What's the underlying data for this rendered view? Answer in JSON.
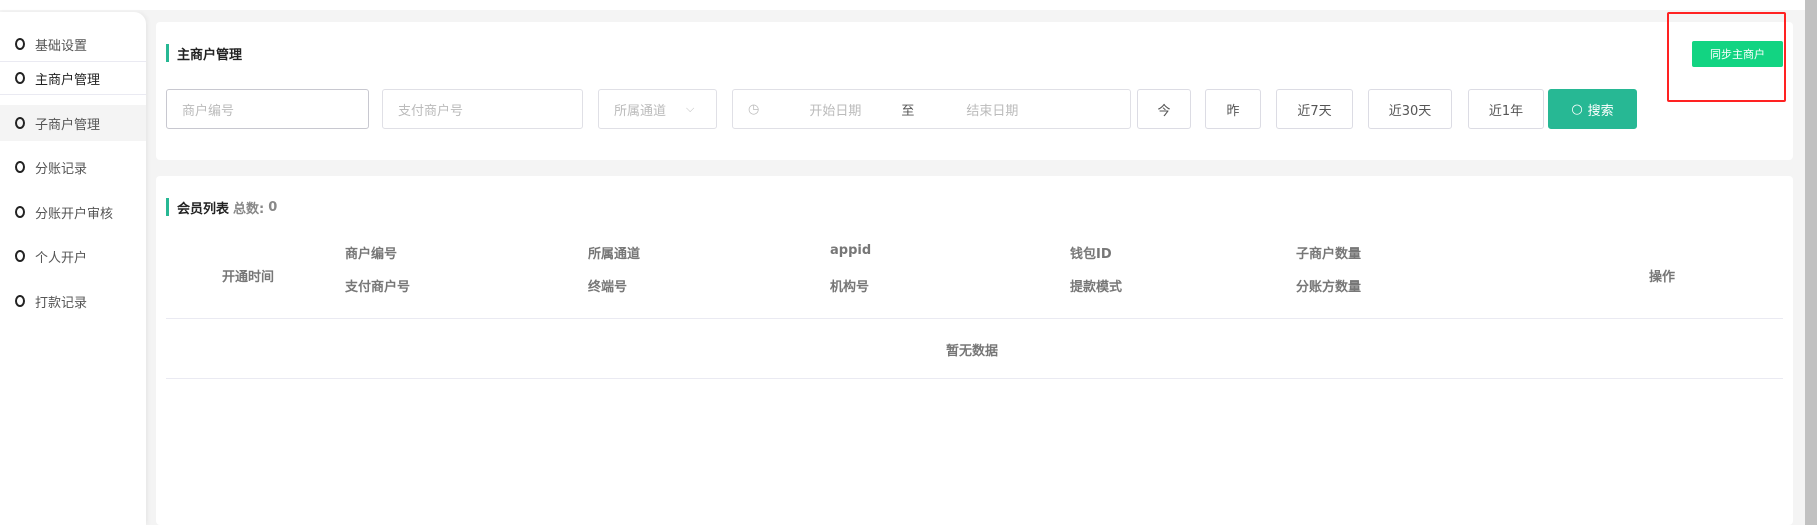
{
  "sidebar": {
    "items": [
      {
        "label": "基础设置"
      },
      {
        "label": "主商户管理"
      },
      {
        "label": "子商户管理"
      },
      {
        "label": "分账记录"
      },
      {
        "label": "分账开户审核"
      },
      {
        "label": "个人开户"
      },
      {
        "label": "打款记录"
      }
    ]
  },
  "filter": {
    "title": "主商户管理",
    "sync_label": "同步主商户",
    "merchant_no_placeholder": "商户编号",
    "pay_merchant_placeholder": "支付商户号",
    "channel_placeholder": "所属通道",
    "start_date_placeholder": "开始日期",
    "date_sep": "至",
    "end_date_placeholder": "结束日期",
    "quick": [
      "今",
      "昨",
      "近7天",
      "近30天",
      "近1年"
    ],
    "search_label": "搜索"
  },
  "list": {
    "title": "会员列表",
    "total_label": "总数:",
    "total": "0",
    "headers": {
      "open_time": "开通时间",
      "merchant_no": "商户编号",
      "pay_merchant_no": "支付商户号",
      "channel": "所属通道",
      "terminal_no": "终端号",
      "appid": "appid",
      "org_no": "机构号",
      "wallet_id": "钱包ID",
      "withdraw_mode": "提款模式",
      "sub_count": "子商户数量",
      "split_count": "分账方数量",
      "action": "操作"
    },
    "empty": "暂无数据"
  },
  "colors": {
    "accent": "#27b894",
    "sync": "#12d482",
    "highlight": "#ff2222"
  }
}
